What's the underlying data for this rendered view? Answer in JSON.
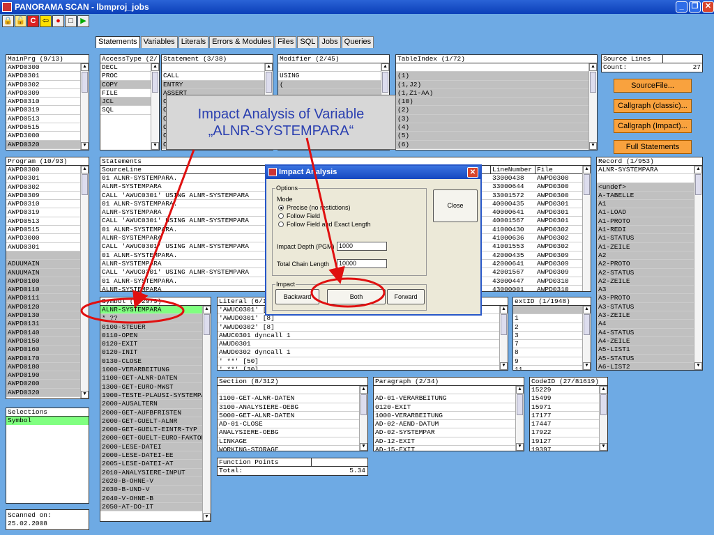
{
  "window": {
    "title": "PANORAMA SCAN - lbmproj_jobs",
    "btn_min": "_",
    "btn_max": "❐",
    "btn_close": "✕"
  },
  "toolbar": {
    "icons": [
      "lock-icon",
      "unlock-icon",
      "c-icon",
      "exit-icon",
      "record-icon",
      "stop-icon",
      "play-icon"
    ],
    "glyphs": [
      "🔒",
      "🔓",
      "C",
      "⇦",
      "●",
      "□",
      "▶"
    ]
  },
  "tabs": [
    "Statements",
    "Variables",
    "Literals",
    "Errors & Modules",
    "Files",
    "SQL",
    "Jobs",
    "Queries"
  ],
  "mainprg": {
    "header": "MainPrg (9/13)",
    "rows": [
      "AWPD0300",
      "AWPD0301",
      "AWPD0302",
      "AWPD0309",
      "AWPD0310",
      "AWPD0319",
      "AWPD0513",
      "AWPD0515",
      "AWPD3000",
      "AWPD0320"
    ]
  },
  "accesstype": {
    "header": "AccessType (2/",
    "rows": [
      "DECL",
      "PROC",
      "COPY",
      "FILE",
      "JCL",
      "SQL"
    ]
  },
  "statement": {
    "header": "Statement (3/38)",
    "rows": [
      "",
      "CALL",
      "ENTRY",
      "ASSERT",
      "C",
      "C",
      "C",
      "C",
      "C",
      "C"
    ]
  },
  "modifier": {
    "header": "Modifier (2/45)",
    "rows": [
      "",
      "USING",
      "(",
      "",
      "",
      "",
      "",
      "",
      "",
      ""
    ]
  },
  "tableindex": {
    "header": "TableIndex (1/72)",
    "rows": [
      "",
      "(1)",
      "(1,J2)",
      "(1,Z1-AA)",
      "(10)",
      "(2)",
      "(3)",
      "(4)",
      "(5)",
      "(6)"
    ]
  },
  "sourcelines": {
    "header": "Source Lines",
    "label": "Count:",
    "value": "27"
  },
  "buttons": {
    "sourcefile": "SourceFile...",
    "callgraph_classic": "Callgraph (classic)...",
    "callgraph_impact": "Callgraph (Impact)...",
    "full_statements": "Full Statements"
  },
  "program": {
    "header": "Program (10/93)",
    "rows": [
      "AWPD0300",
      "AWPD0301",
      "AWPD0302",
      "AWPD0309",
      "AWPD0310",
      "AWPD0319",
      "AWPD0513",
      "AWPD0515",
      "AWPD3000",
      "AWUD0301",
      "",
      "ADUUMAIN",
      "ANUUMAIN",
      "AWPD0100",
      "AWPD0110",
      "AWPD0111",
      "AWPD0120",
      "AWPD0130",
      "AWPD0131",
      "AWPD0140",
      "AWPD0150",
      "AWPD0160",
      "AWPD0170",
      "AWPD0180",
      "AWPD0190",
      "AWPD0200",
      "AWPD0320"
    ]
  },
  "statements": {
    "title": "Statements",
    "col_source": "SourceLine",
    "col_line": "LineNumber",
    "col_file": "File",
    "rows": [
      {
        "src": "01 ALNR-SYSTEMPARA.",
        "line": "33000438",
        "file": "AWPD0300"
      },
      {
        "src": "ALNR-SYSTEMPARA",
        "line": "33000644",
        "file": "AWPD0300"
      },
      {
        "src": "CALL 'AWUC0301' USING ALNR-SYSTEMPARA",
        "line": "33001572",
        "file": "AWPD0300"
      },
      {
        "src": "01 ALNR-SYSTEMPARA.",
        "line": "40000435",
        "file": "AWPD0301"
      },
      {
        "src": "ALNR-SYSTEMPARA",
        "line": "40000641",
        "file": "AWPD0301"
      },
      {
        "src": "CALL 'AWUC0301' USING ALNR-SYSTEMPARA",
        "line": "40001567",
        "file": "AWPD0301"
      },
      {
        "src": "01 ALNR-SYSTEMPARA.",
        "line": "41000430",
        "file": "AWPD0302"
      },
      {
        "src": "ALNR-SYSTEMPARA",
        "line": "41000636",
        "file": "AWPD0302"
      },
      {
        "src": "CALL 'AWUC0301' USING ALNR-SYSTEMPARA",
        "line": "41001553",
        "file": "AWPD0302"
      },
      {
        "src": "01 ALNR-SYSTEMPARA.",
        "line": "42000435",
        "file": "AWPD0309"
      },
      {
        "src": "ALNR-SYSTEMPARA",
        "line": "42000641",
        "file": "AWPD0309"
      },
      {
        "src": "CALL 'AWUC0301' USING ALNR-SYSTEMPARA",
        "line": "42001567",
        "file": "AWPD0309"
      },
      {
        "src": "01 ALNR-SYSTEMPARA.",
        "line": "43000447",
        "file": "AWPD0310"
      },
      {
        "src": "ALNR-SYSTEMPARA",
        "line": "43000001",
        "file": "AWPD0310"
      }
    ]
  },
  "record": {
    "header": "Record (1/953)",
    "rows": [
      "ALNR-SYSTEMPARA",
      "",
      "<undef>",
      "A-TABELLE",
      "A1",
      "A1-LOAD",
      "A1-PROTO",
      "A1-REDI",
      "A1-STATUS",
      "A1-ZEILE",
      "A2",
      "A2-PROTO",
      "A2-STATUS",
      "A2-ZEILE",
      "A3",
      "A3-PROTO",
      "A3-STATUS",
      "A3-ZEILE",
      "A4",
      "A4-STATUS",
      "A4-ZEILE",
      "A5-LIST1",
      "A5-STATUS",
      "A6-LIST2"
    ]
  },
  "symbol": {
    "header": "Symbol (1/2979)",
    "rows": [
      "ALNR-SYSTEMPARA",
      "* ??",
      "0100-STEUER",
      "0110-OPEN",
      "0120-EXIT",
      "0120-INIT",
      "0130-CLOSE",
      "1000-VERARBEITUNG",
      "1100-GET-ALNR-DATEN",
      "1300-GET-EURO-MWST",
      "1900-TESTE-PLAUSI-SYSTEMPA",
      "2000-AUSALTERN",
      "2000-GET-AUFBFRISTEN",
      "2000-GET-GUELT-ALNR",
      "2000-GET-GUELT-EINTR-TYP",
      "2000-GET-GUELT-EURO-FAKTOR",
      "2000-LESE-DATEI",
      "2000-LESE-DATEI-EE",
      "2005-LESE-DATEI-AT",
      "2010-ANALYSIERE-INPUT",
      "2020-B-OHNE-V",
      "2030-B-UND-V",
      "2040-V-OHNE-B",
      "2050-AT-DO-IT"
    ]
  },
  "literal": {
    "header": "Literal (6/1",
    "rows": [
      "'AWUC0301' [",
      "'AWUD0301' [8]",
      "'AWUD0302' [8]",
      "AWUC0301 dyncall 1",
      "AWUD0301",
      "AWUD0302 dyncall 1",
      "'                         **' [50]",
      "'              **' [30]"
    ]
  },
  "extid": {
    "header": "extID (1/1948)",
    "rows": [
      "",
      "1",
      "2",
      "3",
      "7",
      "8",
      "9",
      "11"
    ]
  },
  "section": {
    "header": "Section (8/312)",
    "rows": [
      "",
      "1100-GET-ALNR-DATEN",
      "3100-ANALYSIERE-OEBG",
      "5000-GET-ALNR-DATEN",
      "AD-01-CLOSE",
      "ANALYSIERE-OEBG",
      "LINKAGE",
      "WORKING-STORAGE"
    ]
  },
  "paragraph": {
    "header": "Paragraph (2/34)",
    "rows": [
      "",
      "AD-01-VERARBEITUNG",
      "0120-EXIT",
      "1000-VERARBEITUNG",
      "AD-02-AEND-DATUM",
      "AD-02-SYSTEMPAR",
      "AD-12-EXIT",
      "AD-15-EXIT"
    ]
  },
  "codeid": {
    "header": "CodeID (27/81619)",
    "rows": [
      "15229",
      "15499",
      "15971",
      "17177",
      "17447",
      "17922",
      "19127",
      "19397"
    ]
  },
  "functionpoints": {
    "header": "Function Points",
    "label": "Total:",
    "value": "5.34"
  },
  "selections": {
    "header": "Selections",
    "rows": [
      "Symbol"
    ]
  },
  "scanned": {
    "label": "Scanned on:",
    "date": "25.02.2008"
  },
  "callout": {
    "line1": "Impact Analysis of Variable",
    "line2": "„ALNR-SYSTEMPARA“"
  },
  "dialog": {
    "title": "Impact Analysis",
    "options_label": "Options",
    "mode_label": "Mode",
    "radio_precise": "Precise (no restictions)",
    "radio_follow": "Follow Field",
    "radio_follow_exact": "Follow Field and Exact Length",
    "close": "Close",
    "depth_label": "Impact Depth (PGM)",
    "depth_value": "1000",
    "chain_label": "Total Chain Length",
    "chain_value": "10000",
    "impact_label": "Impact",
    "backward": "Backward",
    "both": "Both",
    "forward": "Forward"
  },
  "colors": {
    "background": "#6eaae4",
    "highlight": "#80ff80",
    "orange": "#f9a23e",
    "annotation": "#e01010"
  }
}
